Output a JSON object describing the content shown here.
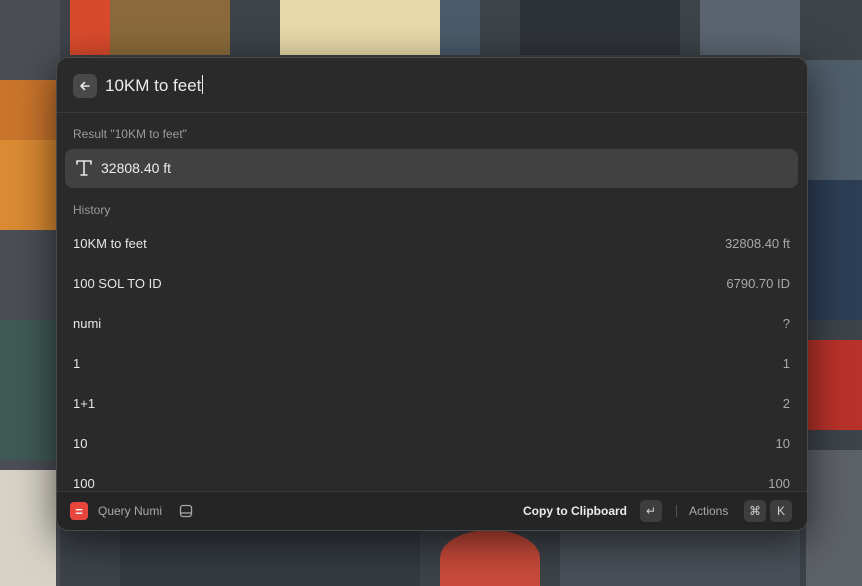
{
  "search": {
    "value": "10KM to feet"
  },
  "result_section": {
    "label": "Result \"10KM to feet\""
  },
  "result": {
    "text": "32808.40 ft",
    "icon": "text-icon"
  },
  "history_section": {
    "label": "History"
  },
  "history": [
    {
      "query": "10KM to feet",
      "result": "32808.40 ft"
    },
    {
      "query": "100 SOL TO ID",
      "result": "6790.70 ID"
    },
    {
      "query": "numi",
      "result": "?"
    },
    {
      "query": "1",
      "result": "1"
    },
    {
      "query": "1+1",
      "result": "2"
    },
    {
      "query": "10",
      "result": "10"
    },
    {
      "query": "100",
      "result": "100"
    }
  ],
  "footer": {
    "app_icon_glyph": "=",
    "title": "Query Numi",
    "primary_action": "Copy to Clipboard",
    "primary_key": "↵",
    "actions_label": "Actions",
    "actions_keys": [
      "⌘",
      "K"
    ]
  },
  "colors": {
    "app_icon": "#e8453c",
    "window_bg": "#2b2a2b",
    "selected_row": "#424142"
  }
}
